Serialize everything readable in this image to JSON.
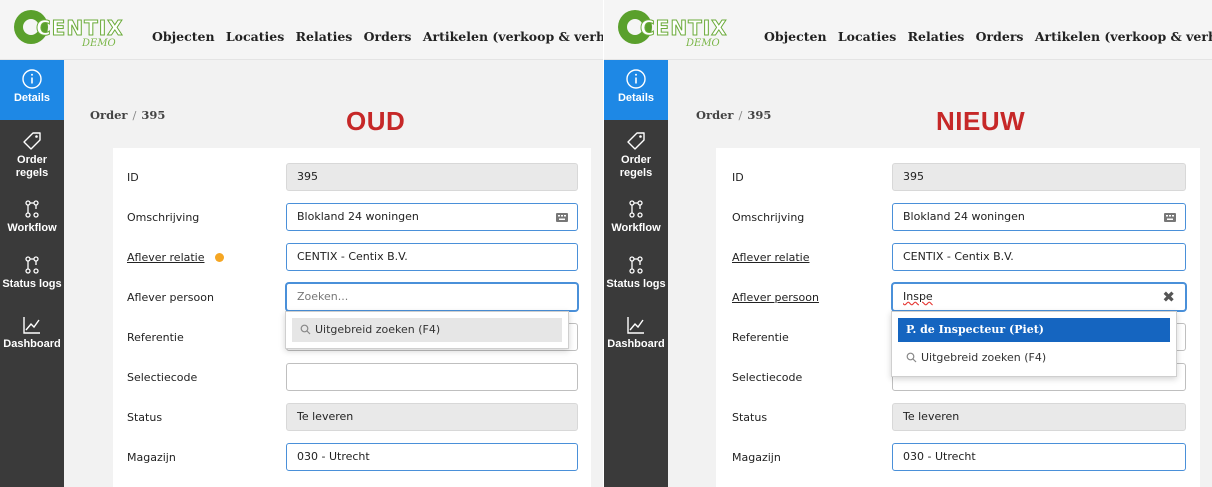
{
  "brand": {
    "name": "CENTIX",
    "edition": "DEMO",
    "color": "#5aa02c"
  },
  "nav": [
    "Objecten",
    "Locaties",
    "Relaties",
    "Orders",
    "Artikelen (verkoop & verhuur)"
  ],
  "sidebar": [
    {
      "label": "Details",
      "icon": "info-icon",
      "active": true
    },
    {
      "label": "Order regels",
      "icon": "tag-icon"
    },
    {
      "label": "Workflow",
      "icon": "workflow-icon"
    },
    {
      "label": "Status logs",
      "icon": "workflow-icon"
    },
    {
      "label": "Dashboard",
      "icon": "chart-icon"
    }
  ],
  "colors": {
    "sidebar_bg": "#3a3a3a",
    "active_blue": "#1e88e5",
    "highlight_red": "#c62828",
    "warning_dot": "#f5a623"
  },
  "panels": {
    "old": {
      "title": "OUD",
      "breadcrumb": {
        "root": "Order",
        "separator": "/",
        "id": "395"
      },
      "labels": {
        "id": "ID",
        "omschrijving": "Omschrijving",
        "aflever_relatie": "Aflever relatie",
        "aflever_persoon": "Aflever persoon",
        "referentie": "Referentie",
        "selectiecode": "Selectiecode",
        "status": "Status",
        "magazijn": "Magazijn"
      },
      "values": {
        "id": "395",
        "omschrijving": "Blokland 24 woningen",
        "aflever_relatie": "CENTIX - Centix B.V.",
        "aflever_persoon_placeholder": "Zoeken...",
        "referentie": "",
        "selectiecode": "",
        "status": "Te leveren",
        "magazijn": "030 - Utrecht"
      },
      "dropdown": {
        "advanced_search": "Uitgebreid zoeken (F4)"
      }
    },
    "new": {
      "title": "NIEUW",
      "breadcrumb": {
        "root": "Order",
        "separator": "/",
        "id": "395"
      },
      "labels": {
        "id": "ID",
        "omschrijving": "Omschrijving",
        "aflever_relatie": "Aflever relatie",
        "aflever_persoon": "Aflever persoon",
        "referentie": "Referentie",
        "selectiecode": "Selectiecode",
        "status": "Status",
        "magazijn": "Magazijn"
      },
      "values": {
        "id": "395",
        "omschrijving": "Blokland 24 woningen",
        "aflever_relatie": "CENTIX - Centix B.V.",
        "aflever_persoon": "Inspe",
        "status": "Te leveren",
        "magazijn": "030 - Utrecht"
      },
      "dropdown": {
        "result": "P. de Inspecteur (Piet)",
        "advanced_search": "Uitgebreid zoeken (F4)"
      }
    }
  }
}
